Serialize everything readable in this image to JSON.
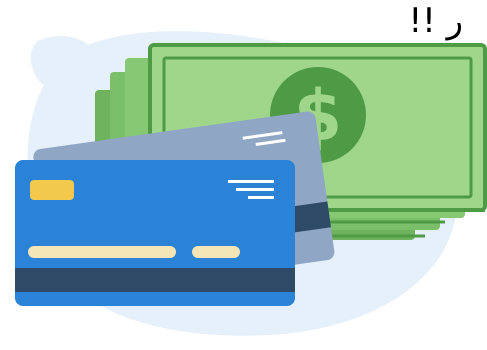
{
  "caption": {
    "text": "ر !!"
  },
  "illustration": {
    "subject": "cash-and-credit-cards",
    "colors": {
      "blob": "#e6f0fa",
      "cash_back": "#7bbf6a",
      "cash_front": "#9fd68a",
      "cash_dark": "#4e9a45",
      "card_back": "#8fa6c4",
      "card_front": "#2a83d6",
      "card_stripe": "#2f4a66",
      "chip": "#f2c94c",
      "line": "#ffffff"
    }
  }
}
